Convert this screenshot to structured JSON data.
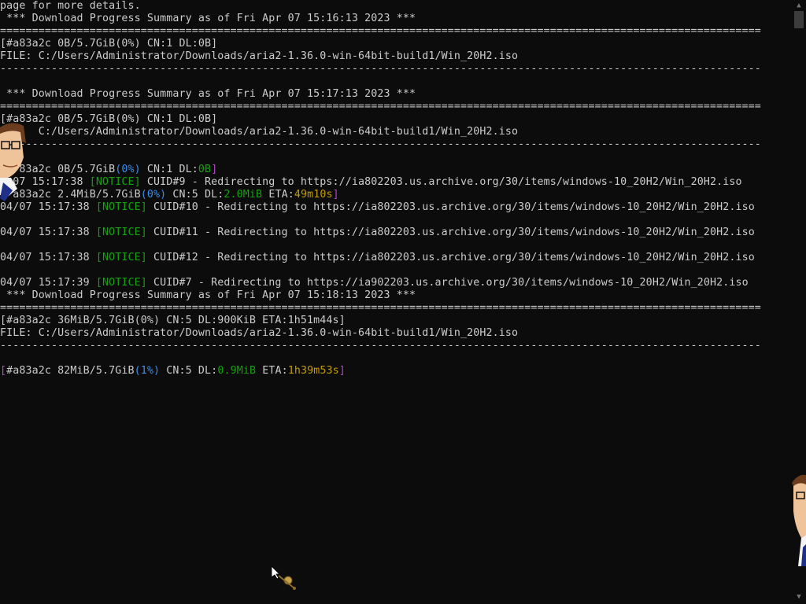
{
  "terminal": {
    "lines": [
      {
        "segments": [
          {
            "text": "page for more details.",
            "color": "default"
          }
        ]
      },
      {
        "segments": [
          {
            "text": " *** Download Progress Summary as of Fri Apr 07 15:16:13 2023 ***",
            "color": "default"
          }
        ]
      },
      {
        "segments": [
          {
            "text": "=======================================================================================================================",
            "color": "default"
          }
        ]
      },
      {
        "segments": [
          {
            "text": "[#a83a2c 0B/5.7GiB(0%) CN:1 DL:0B]",
            "color": "default"
          }
        ]
      },
      {
        "segments": [
          {
            "text": "FILE: C:/Users/Administrator/Downloads/aria2-1.36.0-win-64bit-build1/Win_20H2.iso",
            "color": "default"
          }
        ]
      },
      {
        "segments": [
          {
            "text": "-----------------------------------------------------------------------------------------------------------------------",
            "color": "default"
          }
        ]
      },
      {
        "segments": [
          {
            "text": "",
            "color": "default"
          }
        ]
      },
      {
        "segments": [
          {
            "text": " *** Download Progress Summary as of Fri Apr 07 15:17:13 2023 ***",
            "color": "default"
          }
        ]
      },
      {
        "segments": [
          {
            "text": "=======================================================================================================================",
            "color": "default"
          }
        ]
      },
      {
        "segments": [
          {
            "text": "[#a83a2c 0B/5.7GiB(0%) CN:1 DL:0B]",
            "color": "default"
          }
        ]
      },
      {
        "segments": [
          {
            "text": "      C:/Users/Administrator/Downloads/aria2-1.36.0-win-64bit-build1/Win_20H2.iso",
            "color": "default"
          }
        ]
      },
      {
        "segments": [
          {
            "text": "-----------------------------------------------------------------------------------------------------------------------",
            "color": "default"
          }
        ]
      },
      {
        "segments": [
          {
            "text": "",
            "color": "default"
          }
        ]
      },
      {
        "segments": [
          {
            "text": "   83a2c 0B/5.7GiB",
            "color": "default"
          },
          {
            "text": "(0%)",
            "color": "blue"
          },
          {
            "text": " CN:1 DL:",
            "color": "default"
          },
          {
            "text": "0B",
            "color": "green"
          },
          {
            "text": "]",
            "color": "magenta"
          }
        ]
      },
      {
        "segments": [
          {
            "text": "  07 15:17:38 ",
            "color": "default"
          },
          {
            "text": "[NOTICE]",
            "color": "green"
          },
          {
            "text": " CUID#9 - Redirecting to https://ia802203.us.archive.org/30/items/windows-10_20H2/Win_20H2.iso",
            "color": "default"
          }
        ]
      },
      {
        "segments": [
          {
            "text": "  a83a2c 2.4MiB/5.7GiB",
            "color": "default"
          },
          {
            "text": "(0%)",
            "color": "blue"
          },
          {
            "text": " CN:5 DL:",
            "color": "default"
          },
          {
            "text": "2.0MiB",
            "color": "green"
          },
          {
            "text": " ETA:",
            "color": "default"
          },
          {
            "text": "49m10s",
            "color": "yellow"
          },
          {
            "text": "]",
            "color": "magenta"
          }
        ]
      },
      {
        "segments": [
          {
            "text": "04/07 15:17:38 ",
            "color": "default"
          },
          {
            "text": "[NOTICE]",
            "color": "green"
          },
          {
            "text": " CUID#10 - Redirecting to https://ia802203.us.archive.org/30/items/windows-10_20H2/Win_20H2.iso",
            "color": "default"
          }
        ]
      },
      {
        "segments": [
          {
            "text": "",
            "color": "default"
          }
        ]
      },
      {
        "segments": [
          {
            "text": "04/07 15:17:38 ",
            "color": "default"
          },
          {
            "text": "[NOTICE]",
            "color": "green"
          },
          {
            "text": " CUID#11 - Redirecting to https://ia802203.us.archive.org/30/items/windows-10_20H2/Win_20H2.iso",
            "color": "default"
          }
        ]
      },
      {
        "segments": [
          {
            "text": "",
            "color": "default"
          }
        ]
      },
      {
        "segments": [
          {
            "text": "04/07 15:17:38 ",
            "color": "default"
          },
          {
            "text": "[NOTICE]",
            "color": "green"
          },
          {
            "text": " CUID#12 - Redirecting to https://ia802203.us.archive.org/30/items/windows-10_20H2/Win_20H2.iso",
            "color": "default"
          }
        ]
      },
      {
        "segments": [
          {
            "text": "",
            "color": "default"
          }
        ]
      },
      {
        "segments": [
          {
            "text": "04/07 15:17:39 ",
            "color": "default"
          },
          {
            "text": "[NOTICE]",
            "color": "green"
          },
          {
            "text": " CUID#7 - Redirecting to https://ia902203.us.archive.org/30/items/windows-10_20H2/Win_20H2.iso",
            "color": "default"
          }
        ]
      },
      {
        "segments": [
          {
            "text": " *** Download Progress Summary as of Fri Apr 07 15:18:13 2023 ***",
            "color": "default"
          }
        ]
      },
      {
        "segments": [
          {
            "text": "=======================================================================================================================",
            "color": "default"
          }
        ]
      },
      {
        "segments": [
          {
            "text": "[#a83a2c 36MiB/5.7GiB(0%) CN:5 DL:900KiB ETA:1h51m44s]",
            "color": "default"
          }
        ]
      },
      {
        "segments": [
          {
            "text": "FILE: C:/Users/Administrator/Downloads/aria2-1.36.0-win-64bit-build1/Win_20H2.iso",
            "color": "default"
          }
        ]
      },
      {
        "segments": [
          {
            "text": "-----------------------------------------------------------------------------------------------------------------------",
            "color": "default"
          }
        ]
      },
      {
        "segments": [
          {
            "text": "",
            "color": "default"
          }
        ]
      },
      {
        "segments": [
          {
            "text": "[",
            "color": "magenta"
          },
          {
            "text": "#a83a2c 82MiB/5.7GiB",
            "color": "default"
          },
          {
            "text": "(1%)",
            "color": "blue"
          },
          {
            "text": " CN:5 DL:",
            "color": "default"
          },
          {
            "text": "0.9MiB",
            "color": "green"
          },
          {
            "text": " ETA:",
            "color": "default"
          },
          {
            "text": "1h39m53s",
            "color": "yellow"
          },
          {
            "text": "]",
            "color": "magenta"
          }
        ]
      }
    ]
  },
  "colors": {
    "background": "#0c0c0c",
    "default": "#cccccc",
    "magenta": "#b148c6",
    "blue": "#3b8eea",
    "green": "#13a10e",
    "yellow": "#c19c00"
  },
  "overlays": {
    "left_mascot_icon": "cartoon-man-icon",
    "right_mascot_icon": "cartoon-man-icon",
    "pointer_icon": "pointer-cursor-icon"
  }
}
